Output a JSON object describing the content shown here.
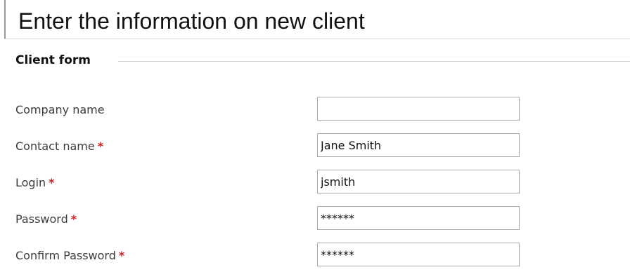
{
  "page": {
    "title": "Enter the information on new client"
  },
  "form": {
    "legend": "Client form",
    "required_marker": "*",
    "fields": [
      {
        "label": "Company name",
        "required": false,
        "value": "",
        "type": "text"
      },
      {
        "label": "Contact name",
        "required": true,
        "value": "Jane Smith",
        "type": "text"
      },
      {
        "label": "Login",
        "required": true,
        "value": "jsmith",
        "type": "text"
      },
      {
        "label": "Password",
        "required": true,
        "value": "******",
        "type": "password"
      },
      {
        "label": "Confirm Password",
        "required": true,
        "value": "******",
        "type": "password"
      }
    ]
  },
  "colors": {
    "required": "#cc2222",
    "input_border": "#a9a9a9",
    "label_text": "#3c3c3c",
    "separator": "#cccccc"
  }
}
